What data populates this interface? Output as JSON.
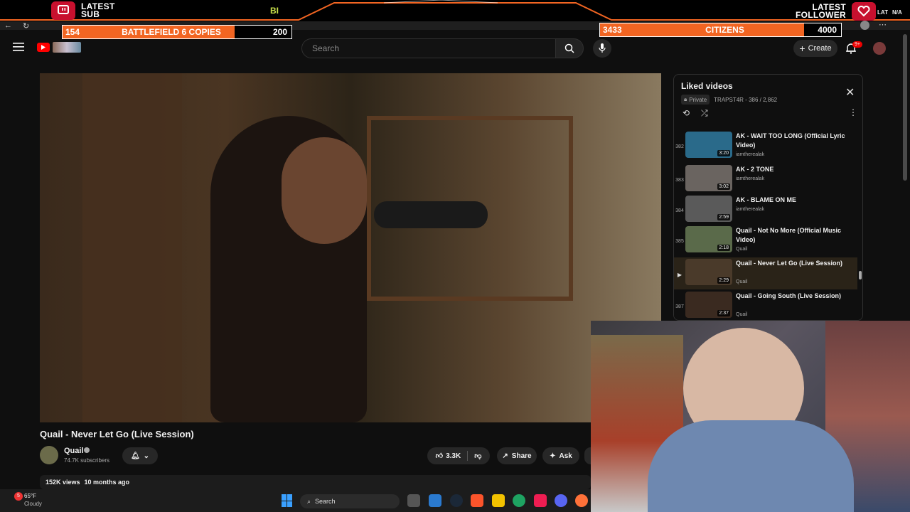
{
  "overlay": {
    "sub_label_1": "LATEST",
    "sub_label_2": "SUB",
    "follow_label_1": "LATEST",
    "follow_label_2": "FOLLOWER",
    "center_logo": "BI",
    "right_text": "N/A",
    "right_prefix": "LAT",
    "goal_left": {
      "current": "154",
      "name": "BATTLEFIELD 6 COPIES",
      "target": "200",
      "progress": 0.77
    },
    "goal_right": {
      "current": "3433",
      "name": "CITIZENS",
      "target": "4000",
      "progress": 0.86
    },
    "accent": "#f26522"
  },
  "masthead": {
    "search_placeholder": "Search",
    "create_label": "Create",
    "notif_badge": "9+"
  },
  "video": {
    "title": "Quail - Never Let Go (Live Session)",
    "channel": "Quail",
    "subscribers": "74.7K subscribers",
    "likes": "3.3K",
    "share_label": "Share",
    "ask_label": "Ask",
    "views": "152K views",
    "age": "10 months ago"
  },
  "playlist": {
    "title": "Liked videos",
    "privacy": "Private",
    "meta": "TRAPST4R - 386 / 2,862",
    "items": [
      {
        "index": "382",
        "title": "AK - WAIT TOO LONG (Official Lyric Video)",
        "channel": "iamtherealak",
        "duration": "3:20"
      },
      {
        "index": "383",
        "title": "AK - 2 TONE",
        "channel": "iamtherealak",
        "duration": "3:02"
      },
      {
        "index": "384",
        "title": "AK - BLAME ON ME",
        "channel": "iamtherealak",
        "duration": "2:59"
      },
      {
        "index": "385",
        "title": "Quail - Not No More (Official Music Video)",
        "channel": "Quail",
        "duration": "2:18"
      },
      {
        "index": "",
        "title": "Quail - Never Let Go (Live Session)",
        "channel": "Quail",
        "duration": "2:29",
        "active": true
      },
      {
        "index": "387",
        "title": "Quail - Going South (Live Session)",
        "channel": "Quail",
        "duration": "2:37"
      }
    ]
  },
  "taskbar": {
    "weather_temp": "65°F",
    "weather_desc": "Cloudy",
    "weather_badge": "5",
    "search_label": "Search"
  }
}
